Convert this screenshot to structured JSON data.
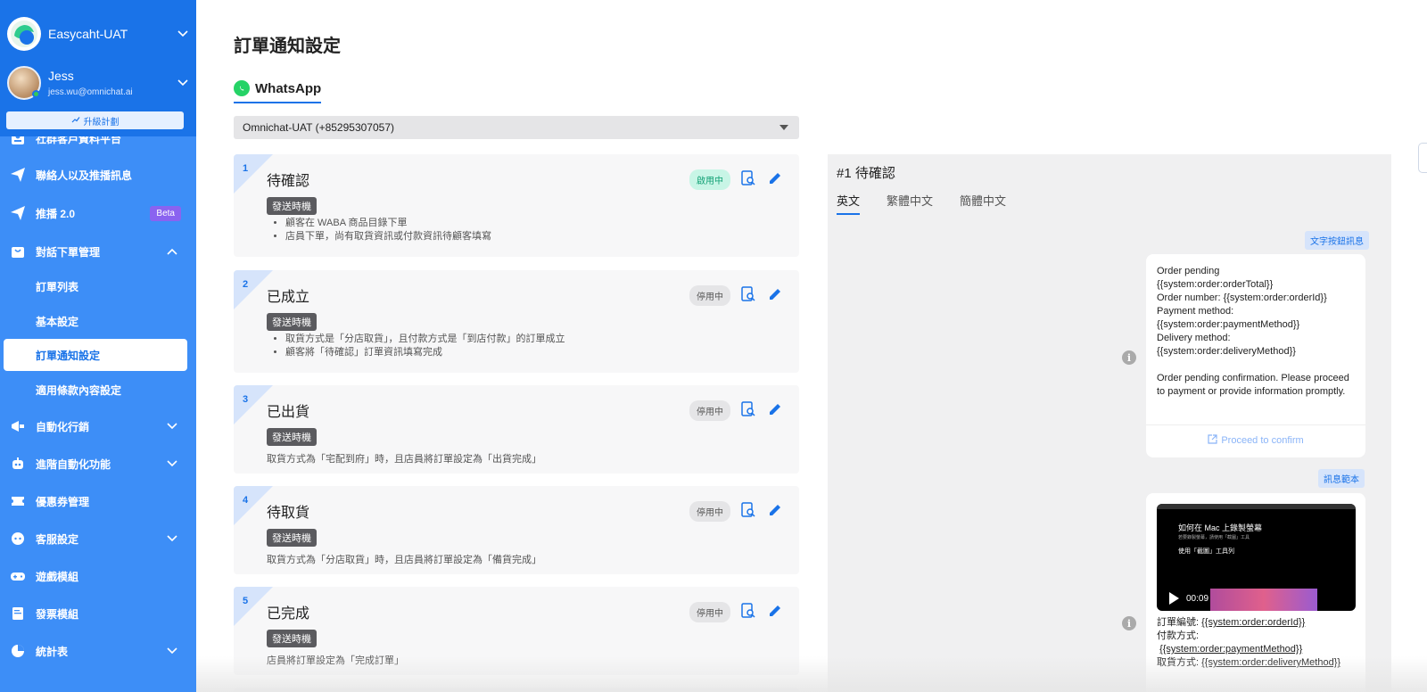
{
  "sidebar": {
    "workspace_name": "Easycaht-UAT",
    "user_name": "Jess",
    "user_email": "jess.wu@omnichat.ai",
    "upgrade_label": "升級計劃",
    "items": [
      {
        "label": "社群客戶資料平台"
      },
      {
        "label": "聯絡人以及推播訊息"
      },
      {
        "label": "推播 2.0",
        "badge": "Beta"
      },
      {
        "label": "對話下單管理"
      },
      {
        "label": "自動化行銷"
      },
      {
        "label": "進階自動化功能"
      },
      {
        "label": "優惠券管理"
      },
      {
        "label": "客服設定"
      },
      {
        "label": "遊戲模組"
      },
      {
        "label": "發票模組"
      },
      {
        "label": "統計表"
      }
    ],
    "sub_items": [
      {
        "label": "訂單列表"
      },
      {
        "label": "基本設定"
      },
      {
        "label": "訂單通知設定"
      },
      {
        "label": "適用條款內容設定"
      }
    ]
  },
  "main": {
    "title": "訂單通知設定",
    "channel_tab": "WhatsApp",
    "account_select": "Omnichat-UAT (+85295307057)",
    "cards": [
      {
        "number": "1",
        "title": "待確認",
        "status": "啟用中",
        "tag": "發送時機",
        "bullets": [
          "顧客在 WABA 商品目錄下單",
          "店員下單，尚有取貨資訊或付款資訊待顧客填寫"
        ]
      },
      {
        "number": "2",
        "title": "已成立",
        "status": "停用中",
        "tag": "發送時機",
        "bullets": [
          "取貨方式是「分店取貨」，且付款方式是「到店付款」的訂單成立",
          "顧客將「待確認」訂單資訊填寫完成"
        ]
      },
      {
        "number": "3",
        "title": "已出貨",
        "status": "停用中",
        "tag": "發送時機",
        "desc": "取貨方式為「宅配到府」時，且店員將訂單設定為「出貨完成」"
      },
      {
        "number": "4",
        "title": "待取貨",
        "status": "停用中",
        "tag": "發送時機",
        "desc": "取貨方式為「分店取貨」時，且店員將訂單設定為「備貨完成」"
      },
      {
        "number": "5",
        "title": "已完成",
        "status": "停用中",
        "tag": "發送時機",
        "desc": "店員將訂單設定為「完成訂單」"
      }
    ]
  },
  "preview": {
    "title": "#1 待確認",
    "lang_tabs": [
      "英文",
      "繁體中文",
      "簡體中文"
    ],
    "badge1": "文字按鈕訊息",
    "message1_lines": [
      "Order pending",
      "{{system:order:orderTotal}}",
      "Order number: {{system:order:orderId}}",
      "Payment method:",
      "{{system:order:paymentMethod}}",
      "Delivery method:",
      "{{system:order:deliveryMethod}}",
      "",
      "Order pending confirmation. Please proceed to payment or provide information promptly."
    ],
    "message1_button": "Proceed to confirm",
    "badge2": "訊息範本",
    "video": {
      "title": "如何在 Mac 上錄製螢幕",
      "subtitle": "若要錄製螢幕，請使用「截圖」工具",
      "tool_label": "使用「截圖」工具列",
      "time": "00:09"
    },
    "message2": {
      "order_id_label": "訂單編號:",
      "order_id_var": "{{system:order:orderId}}",
      "payment_label": "付款方式:",
      "payment_var": "{{system:order:paymentMethod}}",
      "delivery_label": "取貨方式:",
      "delivery_var": "{{system:order:deliveryMethod}}"
    }
  },
  "colors": {
    "brand": "#1a73e8",
    "sidebar": "#3d8ef7",
    "whatsapp": "#25d366",
    "beta": "#8a63f0"
  }
}
